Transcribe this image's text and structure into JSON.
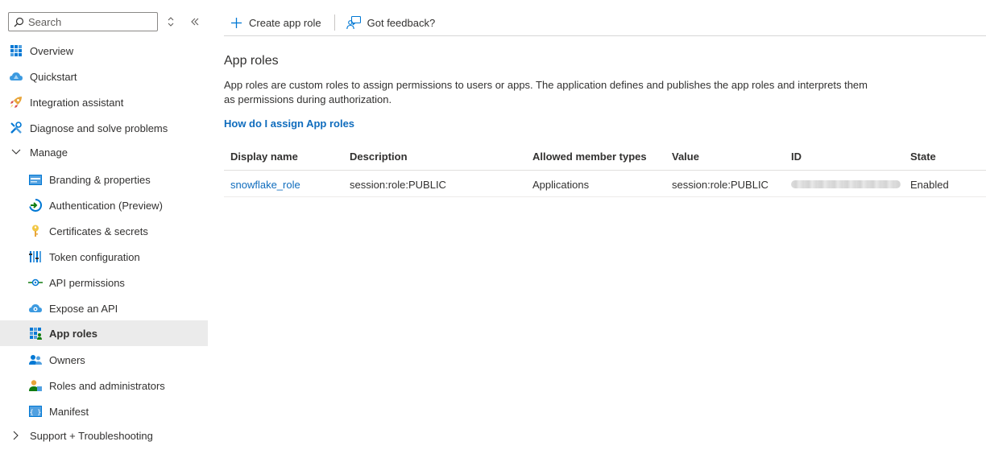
{
  "sidebar": {
    "search_placeholder": "Search",
    "items": [
      {
        "label": "Overview",
        "icon": "overview-grid-icon"
      },
      {
        "label": "Quickstart",
        "icon": "cloud-quickstart-icon"
      },
      {
        "label": "Integration assistant",
        "icon": "rocket-icon"
      },
      {
        "label": "Diagnose and solve problems",
        "icon": "wrench-icon"
      },
      {
        "label": "Manage",
        "icon": "chevron-down-icon"
      },
      {
        "label": "Branding & properties",
        "icon": "branding-card-icon"
      },
      {
        "label": "Authentication (Preview)",
        "icon": "authentication-icon"
      },
      {
        "label": "Certificates & secrets",
        "icon": "key-icon"
      },
      {
        "label": "Token configuration",
        "icon": "token-bars-icon"
      },
      {
        "label": "API permissions",
        "icon": "api-permissions-icon"
      },
      {
        "label": "Expose an API",
        "icon": "cloud-api-icon"
      },
      {
        "label": "App roles",
        "icon": "app-roles-grid-icon"
      },
      {
        "label": "Owners",
        "icon": "owners-people-icon"
      },
      {
        "label": "Roles and administrators",
        "icon": "person-roles-icon"
      },
      {
        "label": "Manifest",
        "icon": "manifest-braces-icon"
      },
      {
        "label": "Support + Troubleshooting",
        "icon": "chevron-right-icon"
      }
    ]
  },
  "toolbar": {
    "create_label": "Create app role",
    "feedback_label": "Got feedback?"
  },
  "main": {
    "title": "App roles",
    "description_line1": "App roles are custom roles to assign permissions to users or apps. The application defines and publishes the app roles and interprets them",
    "description_line2": "as permissions during authorization.",
    "help_link": "How do I assign App roles"
  },
  "table": {
    "columns": [
      "Display name",
      "Description",
      "Allowed member types",
      "Value",
      "ID",
      "State"
    ],
    "rows": [
      {
        "display_name": "snowflake_role",
        "description": "session:role:PUBLIC",
        "allowed_member_types": "Applications",
        "value": "session:role:PUBLIC",
        "state": "Enabled"
      }
    ]
  },
  "colors": {
    "link": "#0f6cbd",
    "selected_bg": "#ebebeb",
    "accent_blue": "#0078d4"
  }
}
